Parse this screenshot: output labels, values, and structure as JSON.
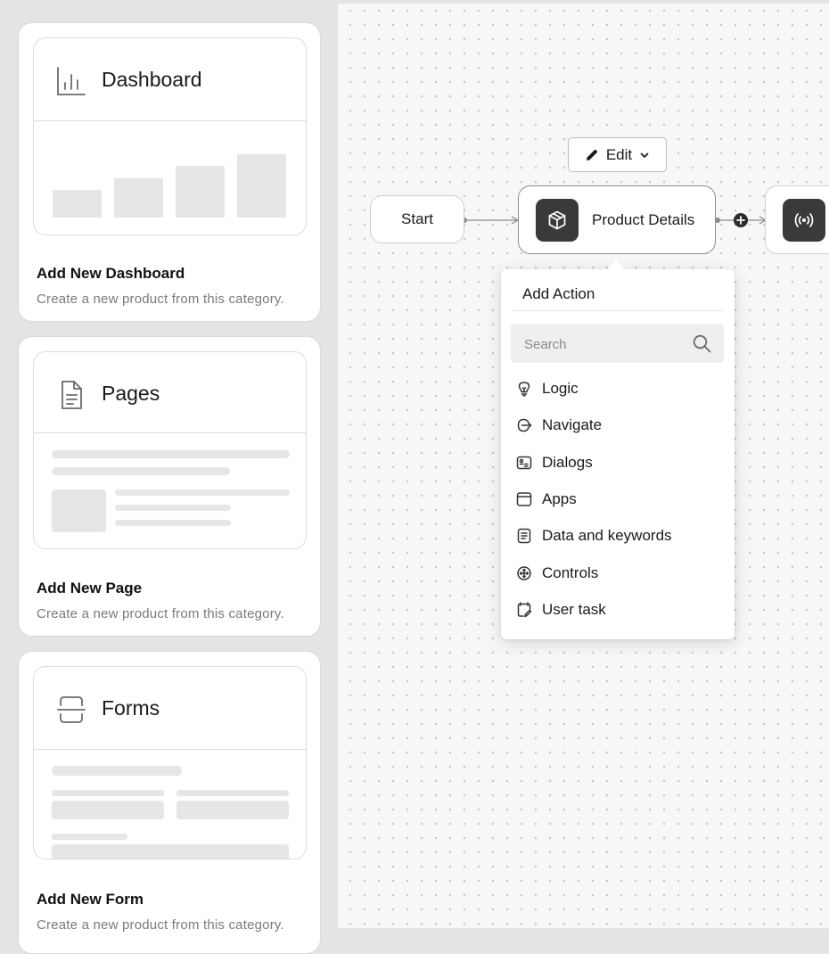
{
  "cards": [
    {
      "preview_title": "Dashboard",
      "title": "Add New Dashboard",
      "description": "Create a new product from this category.",
      "icon": "bar-chart-icon"
    },
    {
      "preview_title": "Pages",
      "title": "Add New Page",
      "description": "Create a new product from this category.",
      "icon": "document-icon"
    },
    {
      "preview_title": "Forms",
      "title": "Add New Form",
      "description": "Create a new product from this category.",
      "icon": "form-icon"
    }
  ],
  "flow": {
    "start_label": "Start",
    "product_label": "Product Details",
    "product_icon": "box-icon",
    "next_icon": "broadcast-icon",
    "add_icon": "plus-circle-icon"
  },
  "edit_button": {
    "label": "Edit",
    "icon": "pencil-icon",
    "chevron": "chevron-down-icon"
  },
  "add_action": {
    "title": "Add Action",
    "search_placeholder": "Search",
    "items": [
      {
        "label": "Logic",
        "icon": "lightbulb-icon"
      },
      {
        "label": "Navigate",
        "icon": "navigate-icon"
      },
      {
        "label": "Dialogs",
        "icon": "dialog-icon"
      },
      {
        "label": "Apps",
        "icon": "app-window-icon"
      },
      {
        "label": "Data and keywords",
        "icon": "data-document-icon"
      },
      {
        "label": "Controls",
        "icon": "controls-icon"
      },
      {
        "label": "User task",
        "icon": "user-task-icon"
      }
    ]
  },
  "colors": {
    "panel_bg": "#e4e4e4",
    "canvas_bg": "#f7f7f7",
    "node_icon_bg": "#3a3a3a",
    "placeholder_gray": "#e6e6e6"
  }
}
